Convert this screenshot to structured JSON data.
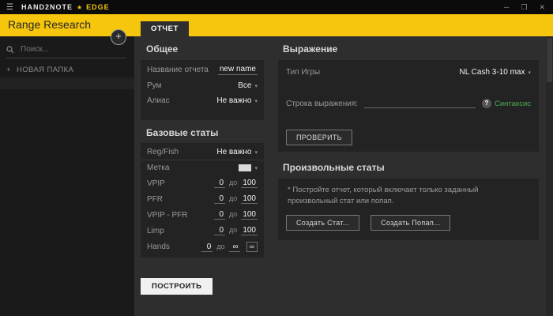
{
  "titlebar": {
    "menu_icon": "☰",
    "brand": "HAND2NOTE",
    "star": "★",
    "edition": "EDGE",
    "minimize": "─",
    "maximize": "❐",
    "close": "✕"
  },
  "header": {
    "title": "Range Research",
    "add_button": "+",
    "tab_label": "ОТЧЕТ"
  },
  "sidebar": {
    "search_placeholder": "Поиск...",
    "new_folder_plus": "+",
    "new_folder": "НОВАЯ ПАПКА"
  },
  "ui": {
    "caret": "▾"
  },
  "general": {
    "heading": "Общее",
    "report_name_label": "Название отчета",
    "report_name_value": "new name",
    "room_label": "Рум",
    "room_value": "Все",
    "alias_label": "Алиас",
    "alias_value": "Не важно"
  },
  "base_stats": {
    "heading": "Базовые статы",
    "regfish_label": "Reg/Fish",
    "regfish_value": "Не важно",
    "metka_label": "Метка",
    "ranges": [
      {
        "label": "VPIP",
        "from": "0",
        "sep": "до",
        "to": "100"
      },
      {
        "label": "PFR",
        "from": "0",
        "sep": "до",
        "to": "100"
      },
      {
        "label": "VPIP - PFR",
        "from": "0",
        "sep": "до",
        "to": "100"
      },
      {
        "label": "Limp",
        "from": "0",
        "sep": "до",
        "to": "100"
      },
      {
        "label": "Hands",
        "from": "0",
        "sep": "до",
        "to": "∞",
        "infinity_button": "∞"
      }
    ]
  },
  "build_button": "ПОСТРОИТЬ",
  "expression": {
    "heading": "Выражение",
    "game_type_label": "Тип Игры",
    "game_type_value": "NL Cash 3-10 max",
    "expression_label": "Строка выражения:",
    "syntax_icon": "?",
    "syntax_label": "Синтаксис",
    "check_button": "ПРОВЕРИТЬ"
  },
  "custom_stats": {
    "heading": "Произвольные статы",
    "note": "* Постройте отчет, который включает только заданный произвольный стат или попап.",
    "create_stat_button": "Создать Стат...",
    "create_popup_button": "Создать Попап..."
  },
  "colors": {
    "accent": "#f6c60d",
    "syntax_green": "#4caf50",
    "content_bg": "#2e2e2e",
    "panel_bg": "#232323",
    "sidebar_bg": "#1a1a1a",
    "titlebar_bg": "#0b0b0b"
  }
}
